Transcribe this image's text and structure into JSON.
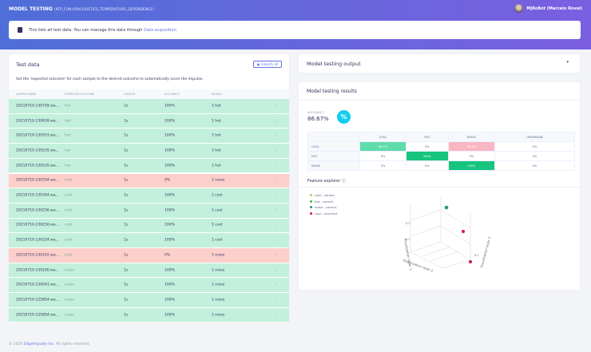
{
  "header": {
    "title": "MODEL TESTING",
    "project": "(KTP_FUN-VOACOUSTICS_TEMPERATURE_DEPENDENCE)",
    "user": "MjRoBot (Marcelo Rovai)"
  },
  "info": {
    "text": "This lists all test data. You can manage this data through",
    "link": "Data acquisition."
  },
  "test_data": {
    "title": "Test data",
    "classify_all": "Classify all",
    "description": "Set the 'expected outcome' for each sample to the desired outcome to automatically score the impulse.",
    "columns": [
      "SAMPLE NAME",
      "EXPECTED OUTCOME",
      "LENGTH",
      "ACCURACY",
      "RESULT"
    ],
    "rows": [
      {
        "name": "20210710-130728.wa...",
        "expected": "hot",
        "length": "1s",
        "accuracy": "100%",
        "result": "1 hot",
        "status": "ok"
      },
      {
        "name": "20210710-130639.wa...",
        "expected": "hot",
        "length": "1s",
        "accuracy": "100%",
        "result": "1 hot",
        "status": "ok"
      },
      {
        "name": "20210710-130553.wa...",
        "expected": "hot",
        "length": "1s",
        "accuracy": "100%",
        "result": "1 hot",
        "status": "ok"
      },
      {
        "name": "20210710-130535.wa...",
        "expected": "hot",
        "length": "1s",
        "accuracy": "100%",
        "result": "1 hot",
        "status": "ok"
      },
      {
        "name": "20210710-130535.wa...",
        "expected": "hot",
        "length": "1s",
        "accuracy": "100%",
        "result": "1 hot",
        "status": "ok"
      },
      {
        "name": "20210710-130334.wa...",
        "expected": "cool",
        "length": "1s",
        "accuracy": "0%",
        "result": "1 noise",
        "status": "bad"
      },
      {
        "name": "20210710-130304.wa...",
        "expected": "cool",
        "length": "1s",
        "accuracy": "100%",
        "result": "1 cool",
        "status": "ok"
      },
      {
        "name": "20210710-130256.wa...",
        "expected": "cool",
        "length": "1s",
        "accuracy": "100%",
        "result": "1 cool",
        "status": "ok"
      },
      {
        "name": "20210710-130256.wa...",
        "expected": "cool",
        "length": "1s",
        "accuracy": "100%",
        "result": "1 cool",
        "status": "ok"
      },
      {
        "name": "20210710-130224.wa...",
        "expected": "cool",
        "length": "1s",
        "accuracy": "100%",
        "result": "1 cool",
        "status": "ok"
      },
      {
        "name": "20210710-130142.wa...",
        "expected": "cool",
        "length": "1s",
        "accuracy": "0%",
        "result": "1 noise",
        "status": "bad"
      },
      {
        "name": "20210710-130100.wa...",
        "expected": "noise",
        "length": "1s",
        "accuracy": "100%",
        "result": "1 noise",
        "status": "ok"
      },
      {
        "name": "20210710-130041.wa...",
        "expected": "noise",
        "length": "1s",
        "accuracy": "100%",
        "result": "1 noise",
        "status": "ok"
      },
      {
        "name": "20210710-125854.wa...",
        "expected": "noise",
        "length": "1s",
        "accuracy": "100%",
        "result": "1 noise",
        "status": "ok"
      },
      {
        "name": "20210710-125854.wa...",
        "expected": "noise",
        "length": "1s",
        "accuracy": "100%",
        "result": "1 noise",
        "status": "ok"
      }
    ]
  },
  "output": {
    "title": "Model testing output"
  },
  "results": {
    "title": "Model testing results",
    "accuracy_label": "ACCURACY",
    "accuracy": "86.67%",
    "matrix": {
      "columns": [
        "COOL",
        "HOT",
        "NOISE",
        "UNCERTAIN"
      ],
      "rows": [
        {
          "label": "COOL",
          "values": [
            "66.7%",
            "0%",
            "33.3%",
            "0%"
          ]
        },
        {
          "label": "HOT",
          "values": [
            "0%",
            "100%",
            "0%",
            "0%"
          ]
        },
        {
          "label": "NOISE",
          "values": [
            "0%",
            "0%",
            "100%",
            "0%"
          ]
        }
      ]
    },
    "feature_explorer": "Feature explorer",
    "legend": [
      {
        "label": "cool - correct",
        "color": "#a6d854"
      },
      {
        "label": "hot - correct",
        "color": "#4caf50"
      },
      {
        "label": "noise - correct",
        "color": "#1a9e6b"
      },
      {
        "label": "cool - incorrect",
        "color": "#d6154e"
      }
    ],
    "axes": {
      "x": "Visualization layer 2",
      "y": "Visualization layer 3",
      "z": "Visualization layer 1",
      "ticks": [
        "0",
        "0.1",
        "0.2"
      ]
    }
  },
  "footer": {
    "copyright": "© 2020",
    "company": "EdgeImpulse Inc.",
    "rights": "All rights reserved."
  }
}
